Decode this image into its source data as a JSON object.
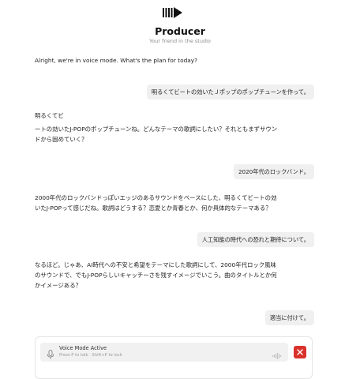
{
  "header": {
    "logo_icon": "waveform-play-icon",
    "title": "Producer",
    "subtitle": "Your friend in the studio"
  },
  "messages": [
    {
      "role": "assistant",
      "lines": [
        "Alright, we're in voice mode. What's the plan for today?"
      ]
    },
    {
      "role": "user",
      "text": "明るくてビートの効いたＪポップのポップチューンを作って。"
    },
    {
      "role": "assistant",
      "lines": [
        "明るくてビ",
        "ートの効いたJ-POPのポップチューンね。どんなテーマの歌詞にしたい？それともまずサウン",
        "ドから固めていく？"
      ]
    },
    {
      "role": "user",
      "text": "2020年代のロックバンド。"
    },
    {
      "role": "assistant",
      "lines": [
        "2000年代のロックバンドっぽいエッジのあるサウンドをベースにした、明るくてビートの効",
        "いたJ-POPって感じだね。歌詞はどうする？恋愛とか青春とか、何か具体的なテーマある？"
      ]
    },
    {
      "role": "user",
      "text": "人工知能の時代への恐れと期待について。"
    },
    {
      "role": "assistant",
      "lines": [
        "なるほど。じゃあ、AI時代への不安と希望をテーマにした歌詞にして、2000年代ロック風味",
        "のサウンドで、でもJ-POPらしいキャッチーさを残すイメージでいこう。曲のタイトルとか何",
        "かイメージある？"
      ]
    },
    {
      "role": "user",
      "text": "適当に付けて。"
    }
  ],
  "composer": {
    "mic_icon": "microphone-icon",
    "status_title": "Voice Mode Active",
    "hint": "Press P to talk · Shift+P to lock",
    "waveform_icon": "audio-wave-icon",
    "stop_icon": "close-icon",
    "stop_color": "#d9312b"
  }
}
